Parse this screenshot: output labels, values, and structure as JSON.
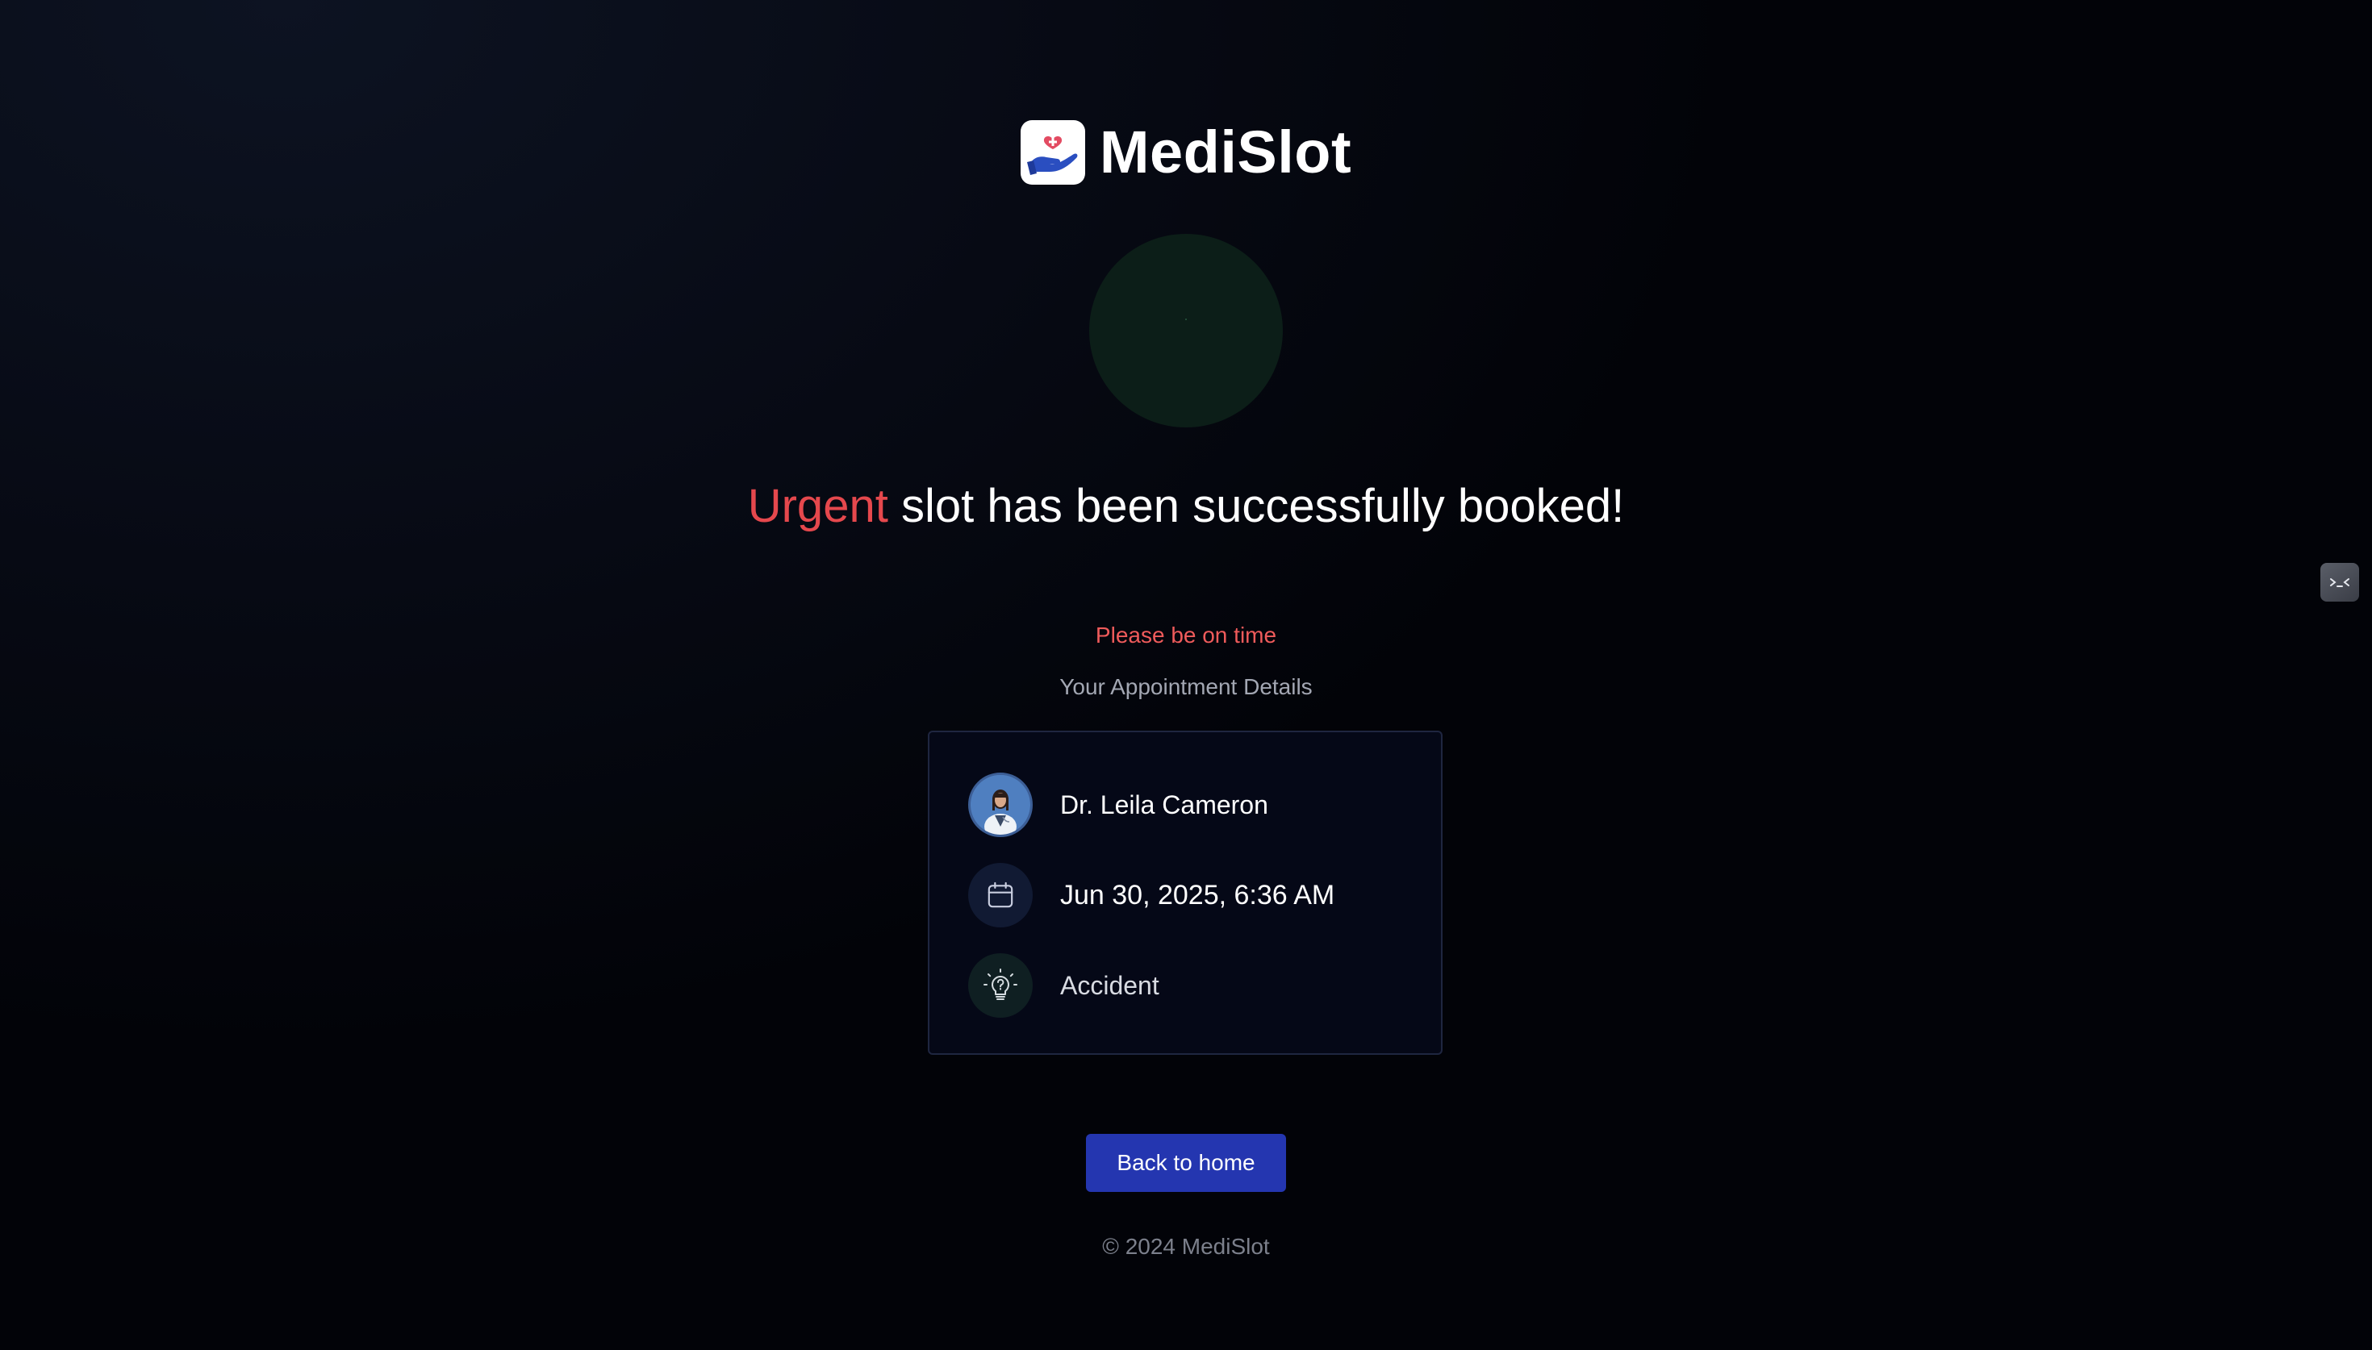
{
  "brand": {
    "name": "MediSlot",
    "logo_icon": "hand-heart-icon"
  },
  "status": {
    "icon": "success-check-icon"
  },
  "headline": {
    "urgency": "Urgent",
    "message": " slot has been successfully booked!"
  },
  "notice": "Please be on time",
  "details_title": "Your Appointment Details",
  "appointment": {
    "doctor": "Dr. Leila Cameron",
    "datetime": "Jun 30, 2025, 6:36 AM",
    "reason": "Accident"
  },
  "actions": {
    "back_label": "Back to home"
  },
  "footer": "© 2024 MediSlot",
  "colors": {
    "urgent": "#e5484d",
    "primary_button": "#2436b0",
    "background": "#050817"
  }
}
